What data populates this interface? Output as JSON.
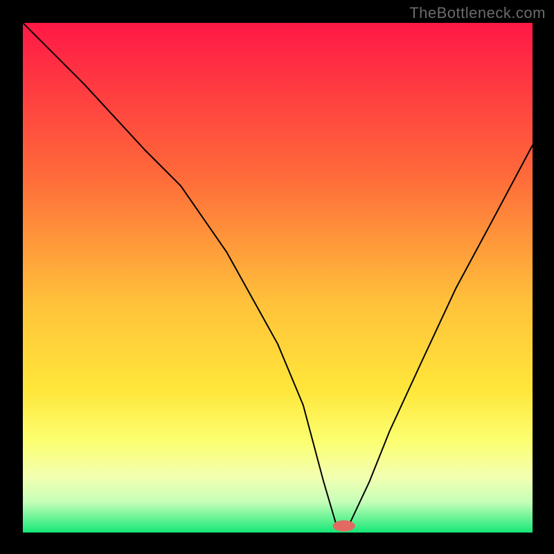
{
  "attribution": "TheBottleneck.com",
  "chart_data": {
    "type": "line",
    "title": "",
    "xlabel": "",
    "ylabel": "",
    "xlim": [
      0,
      100
    ],
    "ylim": [
      0,
      100
    ],
    "grid": false,
    "legend": false,
    "gradient_stops": [
      {
        "offset": 0,
        "color": "#ff1846"
      },
      {
        "offset": 30,
        "color": "#ff6a3a"
      },
      {
        "offset": 55,
        "color": "#ffc23a"
      },
      {
        "offset": 72,
        "color": "#ffe63a"
      },
      {
        "offset": 82,
        "color": "#fcff70"
      },
      {
        "offset": 89,
        "color": "#f3ffb0"
      },
      {
        "offset": 94,
        "color": "#c6ffb8"
      },
      {
        "offset": 100,
        "color": "#16e777"
      }
    ],
    "series": [
      {
        "name": "bottleneck-curve",
        "color": "#000000",
        "x": [
          0,
          12,
          24,
          31,
          40,
          50,
          55,
          59,
          61.5,
          64,
          68,
          72,
          78,
          85,
          92,
          100
        ],
        "y": [
          100,
          88,
          75,
          68,
          55,
          37,
          25,
          10,
          1.5,
          1.5,
          10,
          20,
          33,
          48,
          61,
          76
        ]
      }
    ],
    "marker": {
      "name": "optimal-point",
      "x": 63.0,
      "y": 1.3,
      "rx": 2.2,
      "ry": 1.1,
      "color": "#e26a63"
    }
  }
}
